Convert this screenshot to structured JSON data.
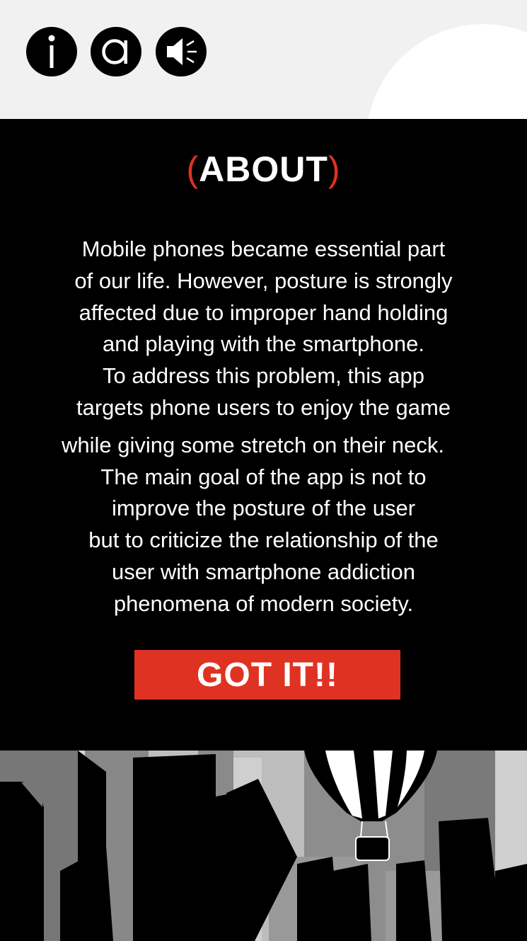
{
  "toolbar": {
    "info_icon": "info-icon",
    "author_icon": "a-letter-icon",
    "sound_icon": "speaker-icon"
  },
  "dialog": {
    "title_open": "(",
    "title": "ABOUT",
    "title_close": ")",
    "text_lines": [
      "Mobile phones became essential part",
      "of our life. However, posture is strongly",
      "affected due to improper hand holding",
      "and playing with the smartphone.",
      "To address this problem, this app",
      "targets phone users to enjoy the game",
      "while giving some stretch on their neck.",
      "The main goal of the app is not to",
      "improve the posture of the user",
      "but to criticize the relationship of the",
      "user with smartphone addiction",
      "phenomena of modern society."
    ],
    "button_label": "GOT IT!!"
  },
  "colors": {
    "accent_red": "#e03222",
    "panel": "#000000",
    "background": "#f1f1f1"
  }
}
